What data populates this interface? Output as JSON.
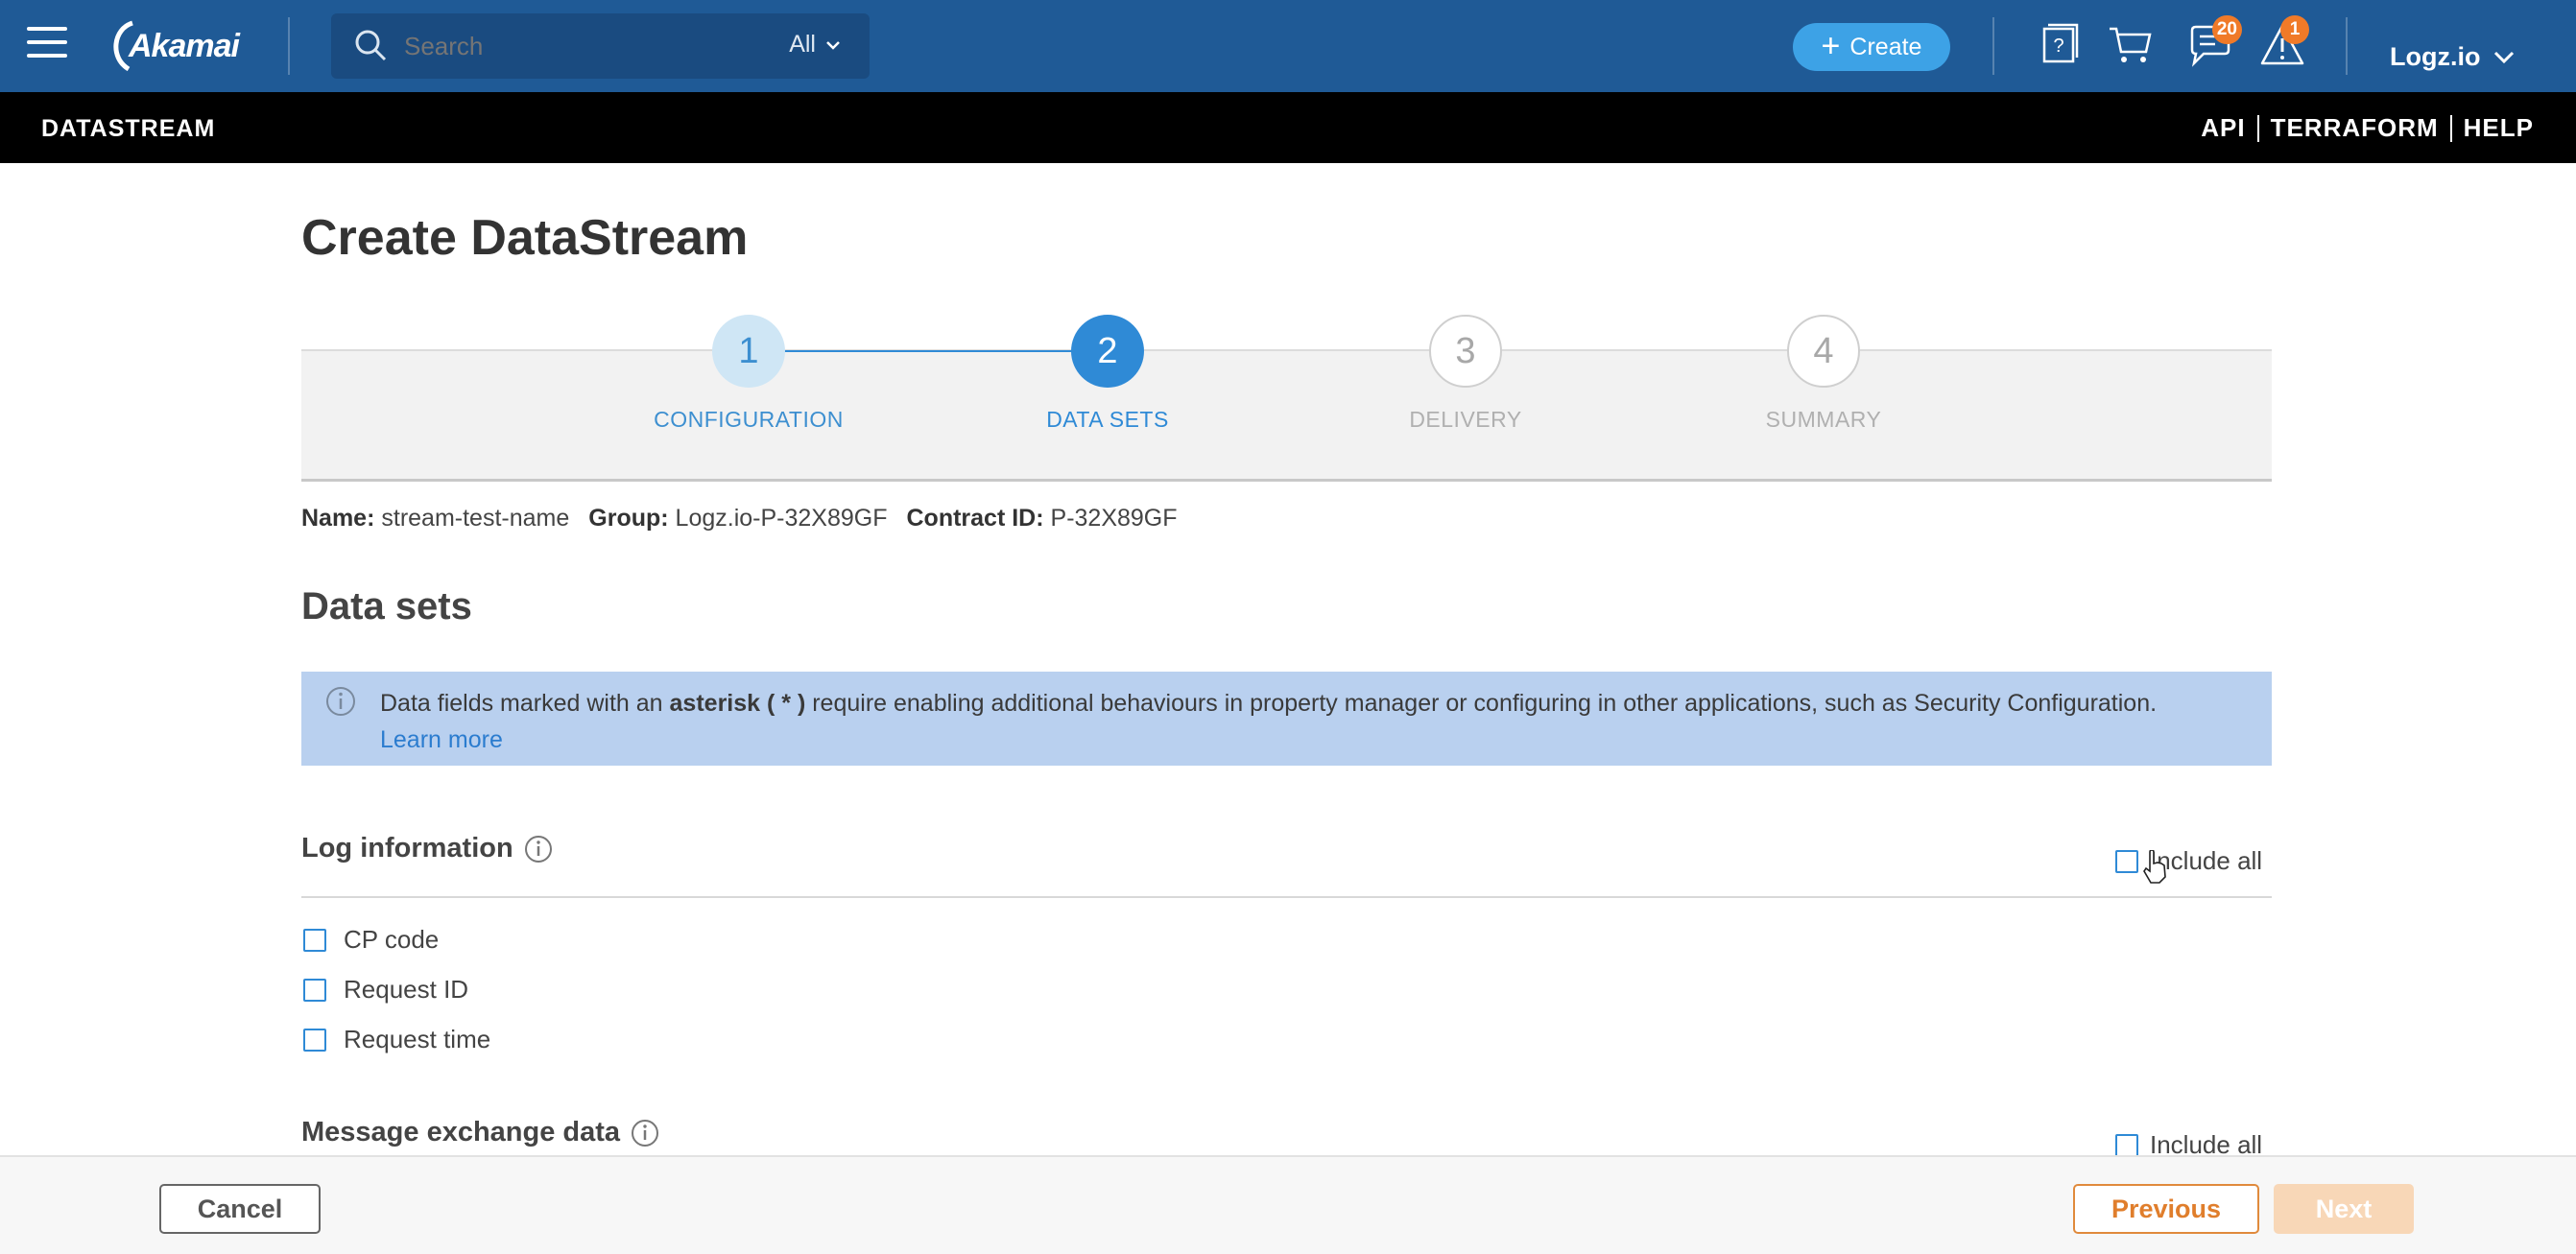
{
  "topbar": {
    "brand": "Akamai",
    "search_placeholder": "Search",
    "search_scope": "All",
    "create_label": "Create",
    "messages_badge": "20",
    "alerts_badge": "1",
    "account_name": "Logz.io",
    "color": "#1f5a96"
  },
  "subbar": {
    "title": "DATASTREAM",
    "links": [
      "API",
      "TERRAFORM",
      "HELP"
    ]
  },
  "page": {
    "title": "Create DataStream"
  },
  "stepper": {
    "steps": [
      {
        "number": "1",
        "label": "CONFIGURATION",
        "state": "done"
      },
      {
        "number": "2",
        "label": "DATA SETS",
        "state": "active"
      },
      {
        "number": "3",
        "label": "DELIVERY",
        "state": "todo"
      },
      {
        "number": "4",
        "label": "SUMMARY",
        "state": "todo"
      }
    ]
  },
  "meta": {
    "name_label": "Name:",
    "name_value": "stream-test-name",
    "group_label": "Group:",
    "group_value": "Logz.io-P-32X89GF",
    "contract_label": "Contract ID:",
    "contract_value": "P-32X89GF"
  },
  "data_sets": {
    "title": "Data sets",
    "banner": {
      "text_before": "Data fields marked with an ",
      "bold": "asterisk ( * )",
      "text_after": " require enabling additional behaviours in property manager or configuring in other applications, such as Security Configuration. ",
      "link": "Learn more"
    },
    "groups": [
      {
        "title": "Log information",
        "include_all_label": "Include all",
        "include_all_checked": false,
        "fields": [
          {
            "label": "CP code",
            "checked": false
          },
          {
            "label": "Request ID",
            "checked": false
          },
          {
            "label": "Request time",
            "checked": false
          }
        ]
      },
      {
        "title": "Message exchange data",
        "include_all_label": "Include all",
        "include_all_checked": false
      }
    ]
  },
  "footer": {
    "cancel_label": "Cancel",
    "previous_label": "Previous",
    "next_label": "Next"
  }
}
